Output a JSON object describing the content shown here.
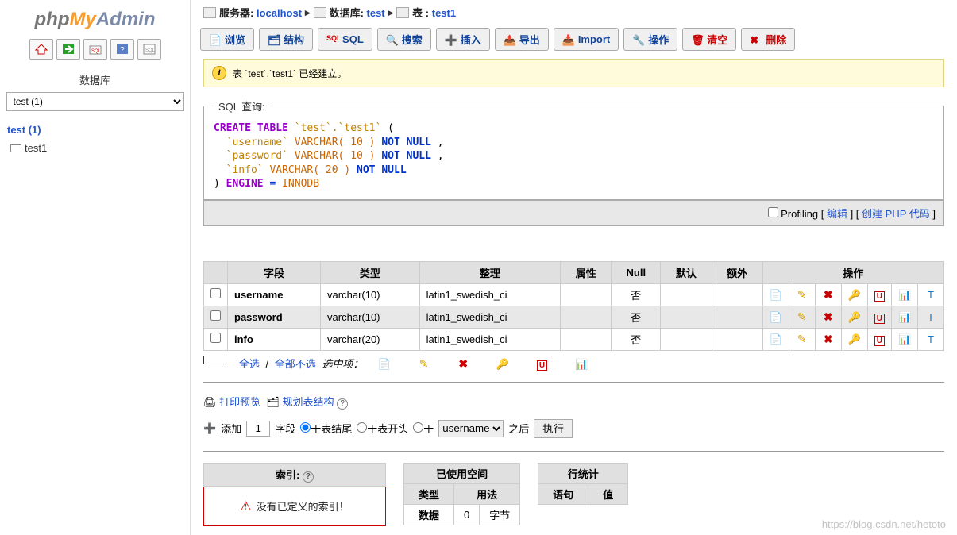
{
  "logo": {
    "p1": "php",
    "p2": "My",
    "p3": "Admin"
  },
  "sidebar": {
    "db_label": "数据库",
    "db_select_value": "test (1)",
    "db_name": "test (1)",
    "tables": [
      "test1"
    ]
  },
  "breadcrumb": {
    "server_label": "服务器: ",
    "server": "localhost",
    "db_label": "数据库: ",
    "db": "test",
    "table_label": "表 : ",
    "table": "test1"
  },
  "tabs": {
    "browse": "浏览",
    "structure": "结构",
    "sql": "SQL",
    "search": "搜索",
    "insert": "插入",
    "export": "导出",
    "import": "Import",
    "operations": "操作",
    "empty": "清空",
    "drop": "删除"
  },
  "message": "表 `test`.`test1` 已经建立。",
  "sql": {
    "legend": "SQL 查询:",
    "create": "CREATE TABLE",
    "fullname": "`test`.`test1`",
    "cols": [
      {
        "name": "`username`",
        "type": "VARCHAR( 10 )",
        "nn": "NOT NULL"
      },
      {
        "name": "`password`",
        "type": "VARCHAR( 10 )",
        "nn": "NOT NULL"
      },
      {
        "name": "`info`",
        "type": "VARCHAR( 20 )",
        "nn": "NOT NULL"
      }
    ],
    "engine_kw": "ENGINE",
    "engine_val": "INNODB",
    "profiling": "Profiling",
    "edit": "编辑",
    "create_php": "创建 PHP 代码"
  },
  "structure": {
    "headers": {
      "field": "字段",
      "type": "类型",
      "collation": "整理",
      "attr": "属性",
      "null": "Null",
      "default": "默认",
      "extra": "额外",
      "action": "操作"
    },
    "rows": [
      {
        "field": "username",
        "type": "varchar(10)",
        "collation": "latin1_swedish_ci",
        "null": "否"
      },
      {
        "field": "password",
        "type": "varchar(10)",
        "collation": "latin1_swedish_ci",
        "null": "否"
      },
      {
        "field": "info",
        "type": "varchar(20)",
        "collation": "latin1_swedish_ci",
        "null": "否"
      }
    ],
    "select_all": "全选",
    "unselect_all": "全部不选",
    "with_selected": "选中项："
  },
  "links": {
    "print": "打印预览",
    "propose": "规划表结构"
  },
  "addfields": {
    "add": "添加",
    "count": "1",
    "fields": "字段",
    "at_end": "于表结尾",
    "at_begin": "于表开头",
    "at": "于",
    "after": "之后",
    "go": "执行",
    "after_field": "username"
  },
  "indexes": {
    "title": "索引:",
    "warn": "没有已定义的索引！"
  },
  "space": {
    "title": "已使用空间",
    "type": "类型",
    "usage": "用法",
    "data": "数据",
    "val": "0",
    "unit": "字节"
  },
  "rowstats": {
    "title": "行统计",
    "stmt": "语句",
    "value": "值"
  },
  "watermark": "https://blog.csdn.net/hetoto"
}
